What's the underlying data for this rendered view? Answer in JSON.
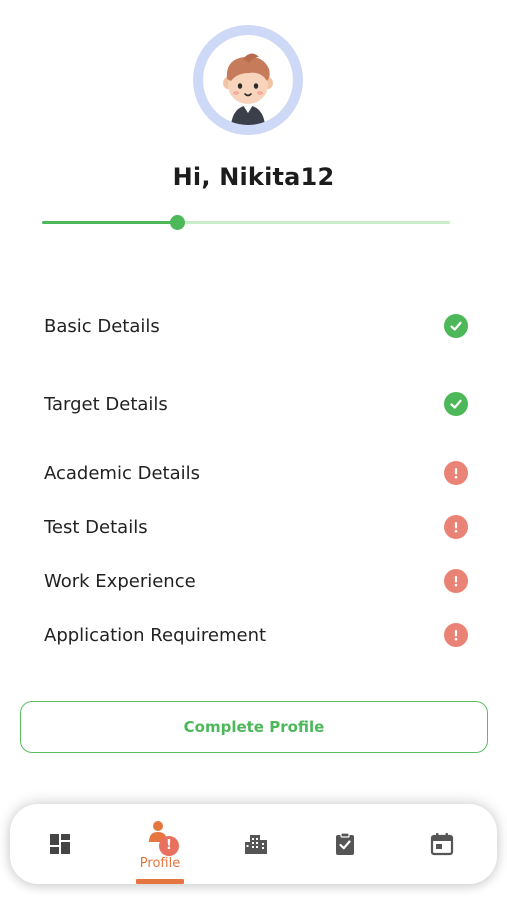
{
  "user": {
    "greeting": "Hi, Nikita12"
  },
  "profile_progress": {
    "value": 0.33
  },
  "sections": [
    {
      "label": "Basic Details",
      "status": "complete",
      "icon": "check-circle-icon"
    },
    {
      "label": "Target Details",
      "status": "complete",
      "icon": "check-circle-icon"
    },
    {
      "label": "Academic Details",
      "status": "incomplete",
      "icon": "exclamation-circle-icon"
    },
    {
      "label": "Test Details",
      "status": "incomplete",
      "icon": "exclamation-circle-icon"
    },
    {
      "label": "Work Experience",
      "status": "incomplete",
      "icon": "exclamation-circle-icon"
    },
    {
      "label": "Application Requirement",
      "status": "incomplete",
      "icon": "exclamation-circle-icon"
    }
  ],
  "actions": {
    "complete_profile_label": "Complete Profile"
  },
  "bottom_nav": {
    "items": [
      {
        "icon": "dashboard-icon",
        "label": ""
      },
      {
        "icon": "profile-icon",
        "label": "Profile",
        "active": true,
        "badge": "!"
      },
      {
        "icon": "buildings-icon",
        "label": ""
      },
      {
        "icon": "clipboard-check-icon",
        "label": ""
      },
      {
        "icon": "calendar-icon",
        "label": ""
      }
    ]
  },
  "colors": {
    "success": "#4cb85a",
    "warning": "#e98375",
    "accent": "#e5763f",
    "avatar_ring": "#cdd9f6"
  }
}
